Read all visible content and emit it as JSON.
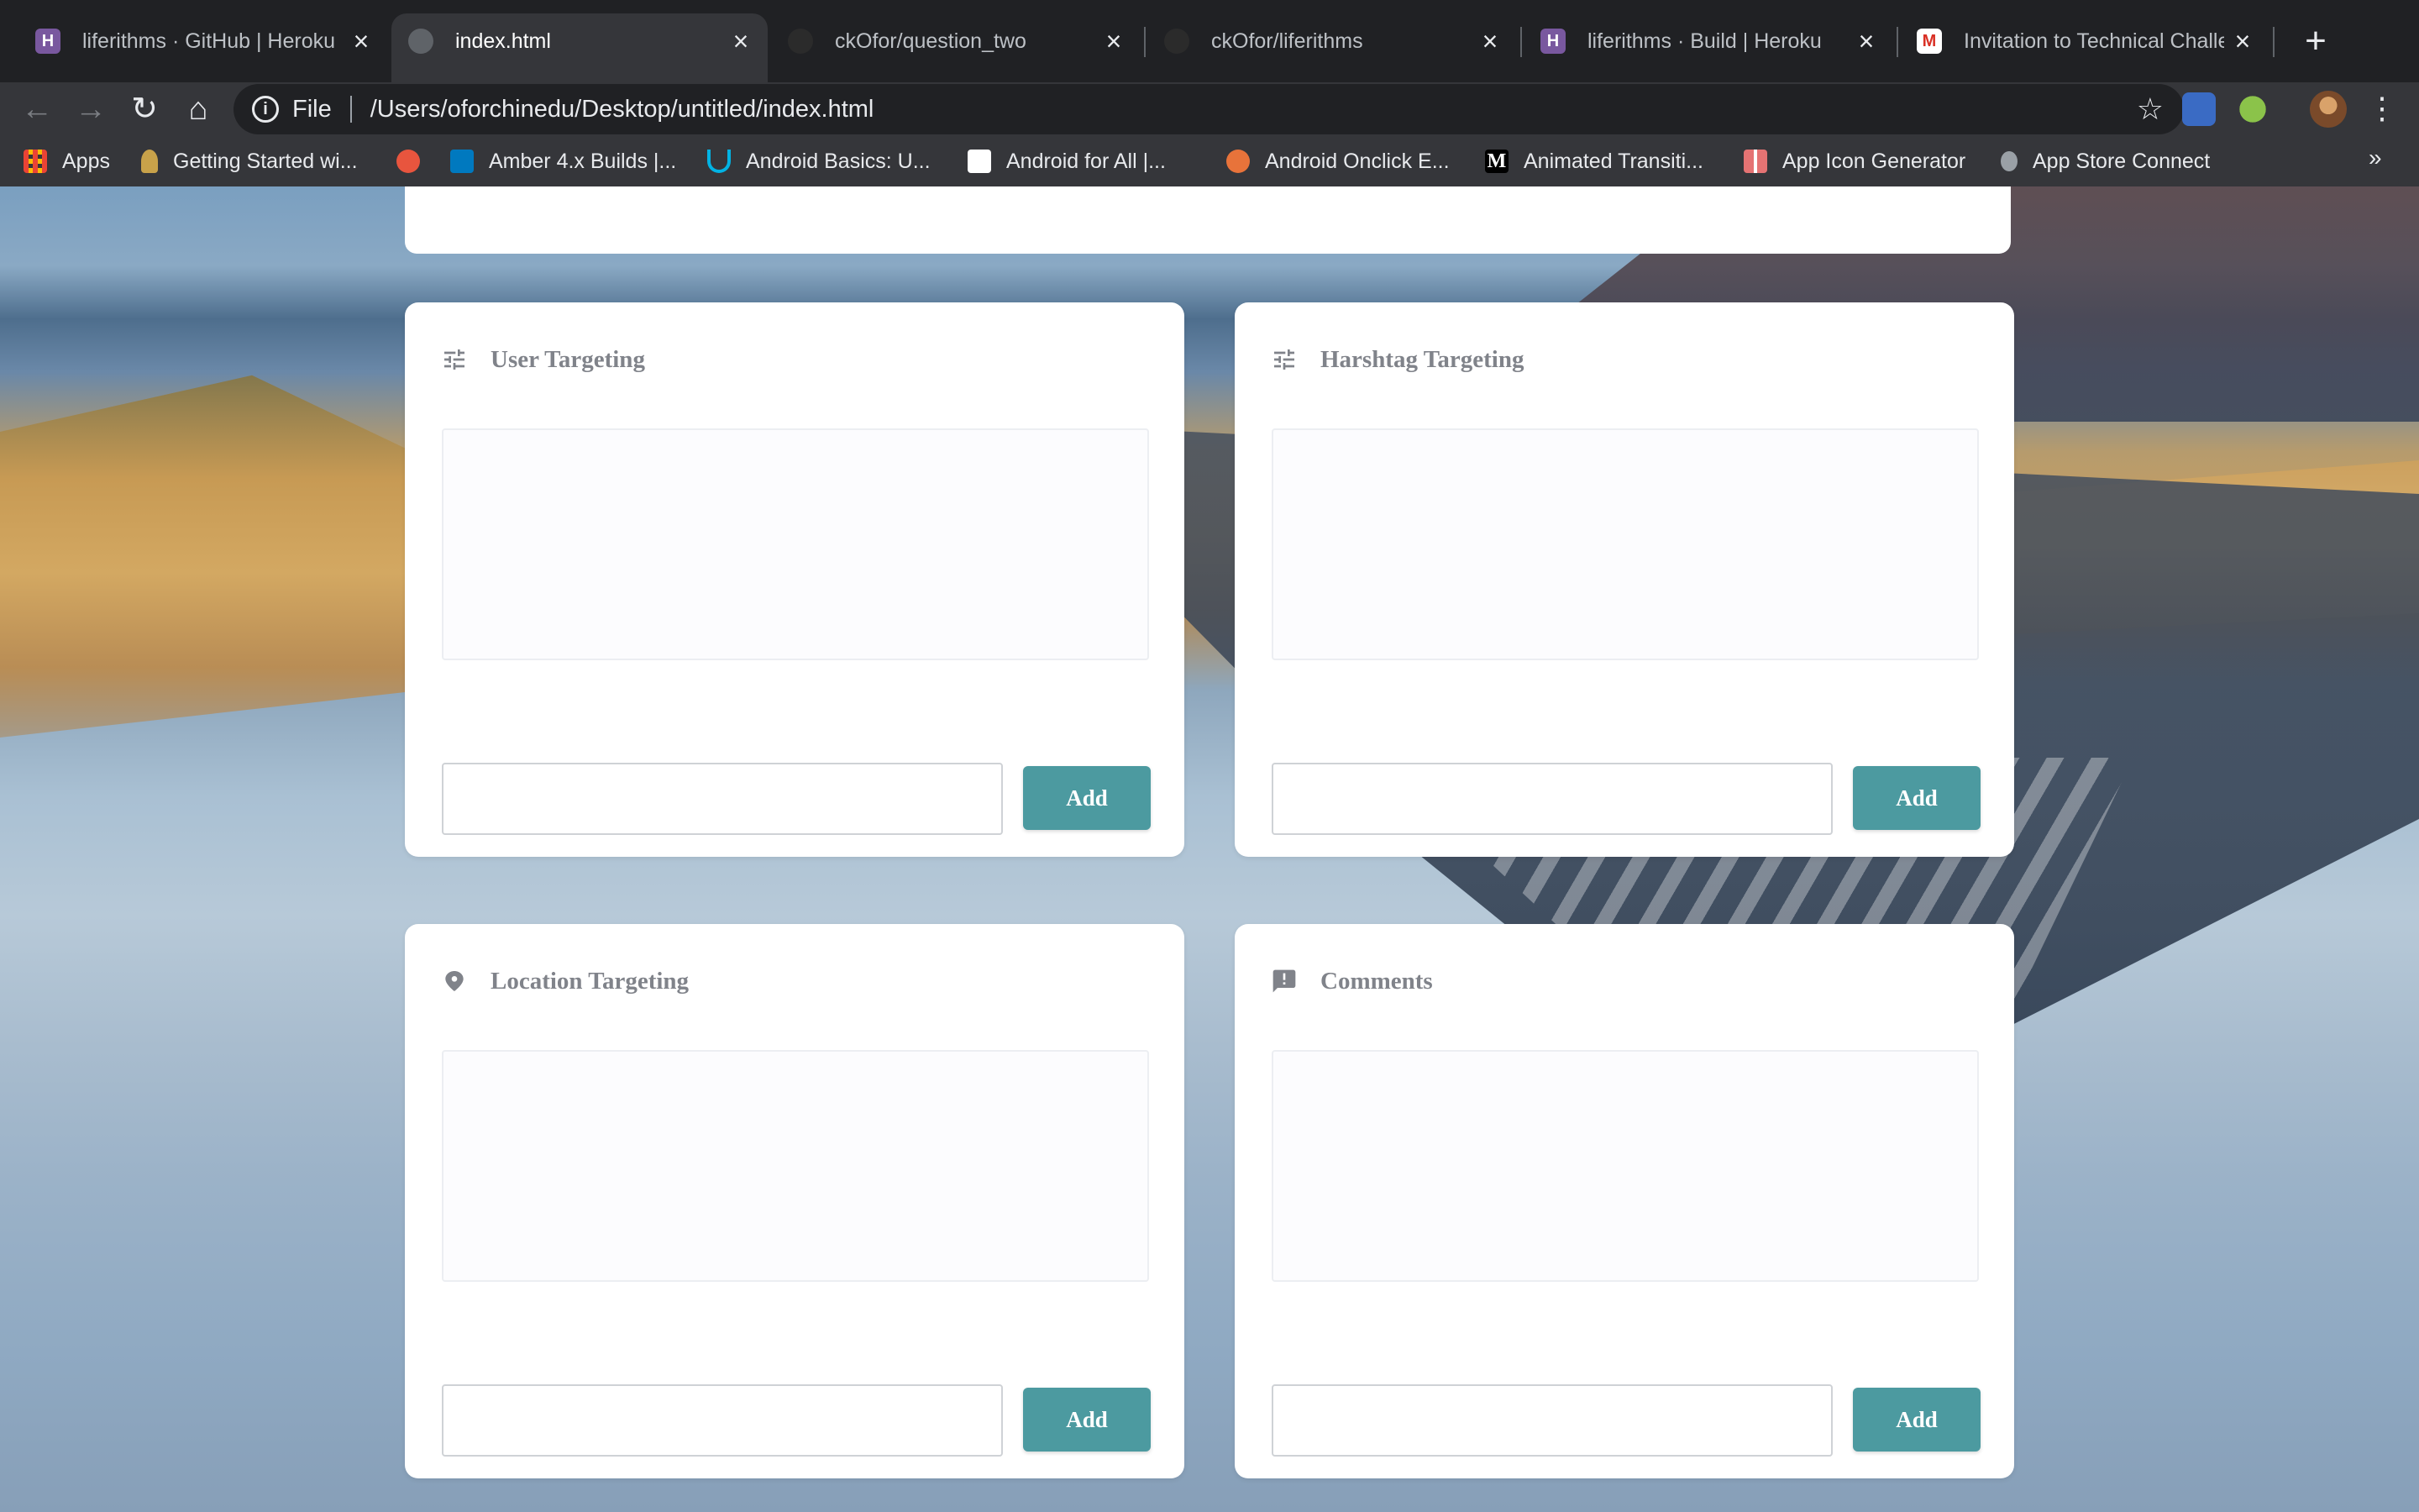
{
  "browser": {
    "tabs": [
      {
        "title": "liferithms · GitHub | Heroku",
        "favicon": "heroku-icon",
        "active": false
      },
      {
        "title": "index.html",
        "favicon": "globe-icon",
        "active": true
      },
      {
        "title": "ckOfor/question_two",
        "favicon": "github-icon",
        "active": false
      },
      {
        "title": "ckOfor/liferithms",
        "favicon": "github-icon",
        "active": false
      },
      {
        "title": "liferithms · Build | Heroku",
        "favicon": "heroku-icon",
        "active": false
      },
      {
        "title": "Invitation to Technical Challe",
        "favicon": "gmail-icon",
        "active": false
      }
    ],
    "address": {
      "scheme_label": "File",
      "url": "/Users/oforchinedu/Desktop/untitled/index.html"
    },
    "bookmarks": [
      {
        "label": "Apps",
        "icon": "apps-grid-icon"
      },
      {
        "label": "Getting Started wi...",
        "icon": "bookmark-icon"
      },
      {
        "label": "",
        "icon": "red-circle-icon"
      },
      {
        "label": "Amber 4.x Builds |...",
        "icon": "trello-icon"
      },
      {
        "label": "Android Basics: U...",
        "icon": "udacity-icon"
      },
      {
        "label": "Android for All  |...",
        "icon": "google-icon"
      },
      {
        "label": "Android Onclick E...",
        "icon": "orange-icon"
      },
      {
        "label": "Animated Transiti...",
        "icon": "medium-icon"
      },
      {
        "label": "App Icon Generator",
        "icon": "grid-icon"
      },
      {
        "label": "App Store Connect",
        "icon": "apple-icon"
      }
    ],
    "more_bookmarks": "»"
  },
  "cards": [
    {
      "title": "User Targeting",
      "icon": "sliders-icon",
      "button": "Add",
      "input_value": ""
    },
    {
      "title": "Harshtag Targeting",
      "icon": "sliders-icon",
      "button": "Add",
      "input_value": ""
    },
    {
      "title": "Location Targeting",
      "icon": "location-icon",
      "button": "Add",
      "input_value": ""
    },
    {
      "title": "Comments",
      "icon": "comment-alert-icon",
      "button": "Add",
      "input_value": ""
    }
  ],
  "colors": {
    "accent": "#4c9aa0",
    "card_title": "#80838a",
    "chrome_bg": "#35363a",
    "tabstrip_bg": "#202124"
  }
}
